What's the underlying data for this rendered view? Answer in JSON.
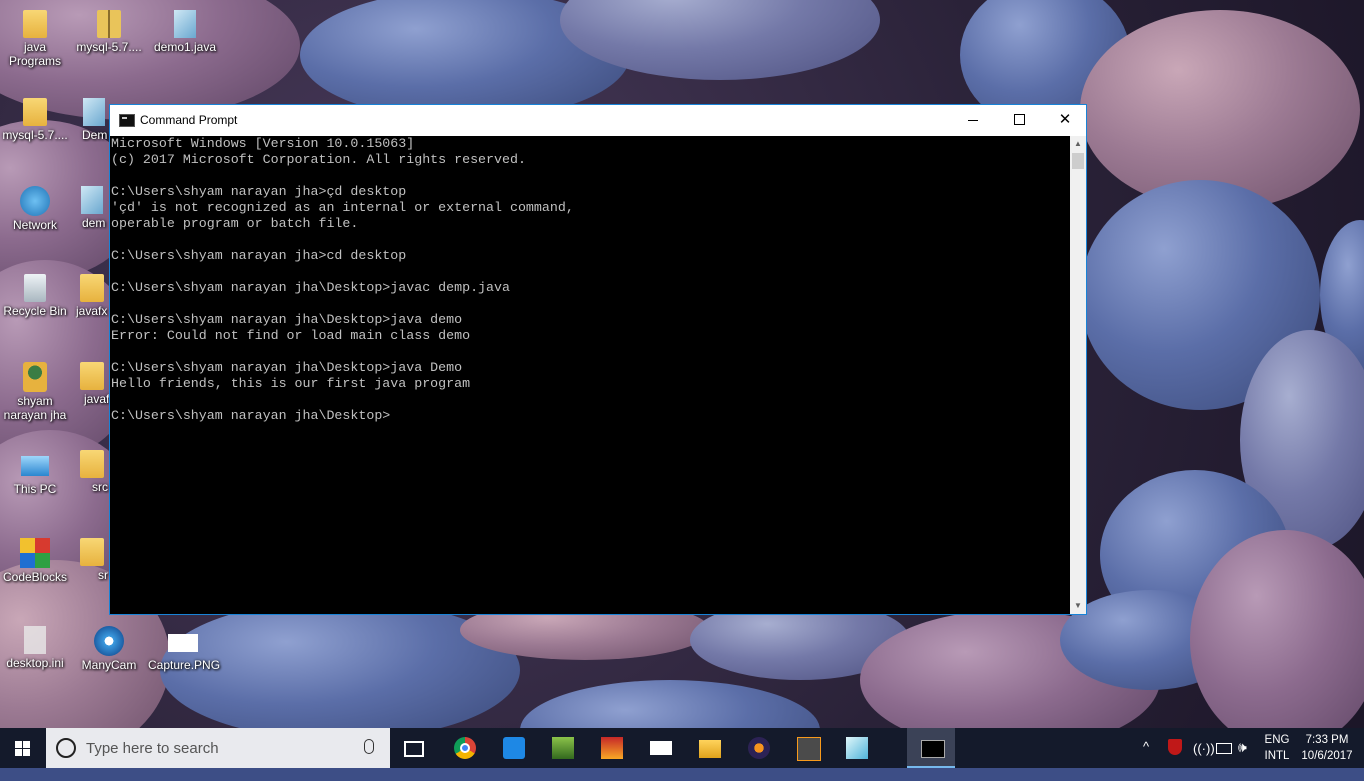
{
  "desktop": {
    "icons": [
      {
        "label": "java\nPrograms",
        "icon": "folder-icon"
      },
      {
        "label": "mysql-5.7....",
        "icon": "zip-folder-icon"
      },
      {
        "label": "demo1.java",
        "icon": "java-file-icon"
      },
      {
        "label": "mysql-5.7....",
        "icon": "folder-icon"
      },
      {
        "label": "Dem",
        "icon": "file-icon"
      },
      {
        "label": "Network",
        "icon": "network-icon"
      },
      {
        "label": "dem",
        "icon": "file-icon"
      },
      {
        "label": "Recycle Bin",
        "icon": "recycle-bin-icon"
      },
      {
        "label": "javafx",
        "icon": "folder-icon"
      },
      {
        "label": "shyam\nnarayan jha",
        "icon": "user-folder-icon"
      },
      {
        "label": "javaf",
        "icon": "folder-icon"
      },
      {
        "label": "This PC",
        "icon": "this-pc-icon"
      },
      {
        "label": "src",
        "icon": "folder-icon"
      },
      {
        "label": "CodeBlocks",
        "icon": "codeblocks-icon"
      },
      {
        "label": "sr",
        "icon": "folder-icon"
      },
      {
        "label": "desktop.ini",
        "icon": "ini-file-icon"
      },
      {
        "label": "ManyCam",
        "icon": "manycam-icon"
      },
      {
        "label": "Capture.PNG",
        "icon": "png-file-icon"
      }
    ]
  },
  "window": {
    "title": "Command Prompt",
    "controls": {
      "minimize": "minimize",
      "maximize": "maximize",
      "close": "✕"
    },
    "console_lines": [
      "Microsoft Windows [Version 10.0.15063]",
      "(c) 2017 Microsoft Corporation. All rights reserved.",
      "",
      "C:\\Users\\shyam narayan jha>çd desktop",
      "'çd' is not recognized as an internal or external command,",
      "operable program or batch file.",
      "",
      "C:\\Users\\shyam narayan jha>cd desktop",
      "",
      "C:\\Users\\shyam narayan jha\\Desktop>javac demp.java",
      "",
      "C:\\Users\\shyam narayan jha\\Desktop>java demo",
      "Error: Could not find or load main class demo",
      "",
      "C:\\Users\\shyam narayan jha\\Desktop>java Demo",
      "Hello friends, this is our first java program",
      "",
      "C:\\Users\\shyam narayan jha\\Desktop>"
    ],
    "scroll": {
      "up": "▲",
      "down": "▼"
    }
  },
  "taskbar": {
    "search_placeholder": "Type here to search",
    "apps": [
      "task-view",
      "chrome",
      "app",
      "app",
      "app",
      "mail",
      "file-explorer",
      "eclipse",
      "sublime-text",
      "notepad",
      "command-prompt"
    ],
    "tray": {
      "chevron": "^",
      "wifi": "((·))",
      "volume": "🕪",
      "lang_line1": "ENG",
      "lang_line2": "INTL",
      "time": "7:33 PM",
      "date": "10/6/2017"
    }
  },
  "colors": {
    "accent": "#1883d7",
    "taskbar": "#141a2b",
    "console_bg": "#000000",
    "console_fg": "#c0c0c0"
  }
}
